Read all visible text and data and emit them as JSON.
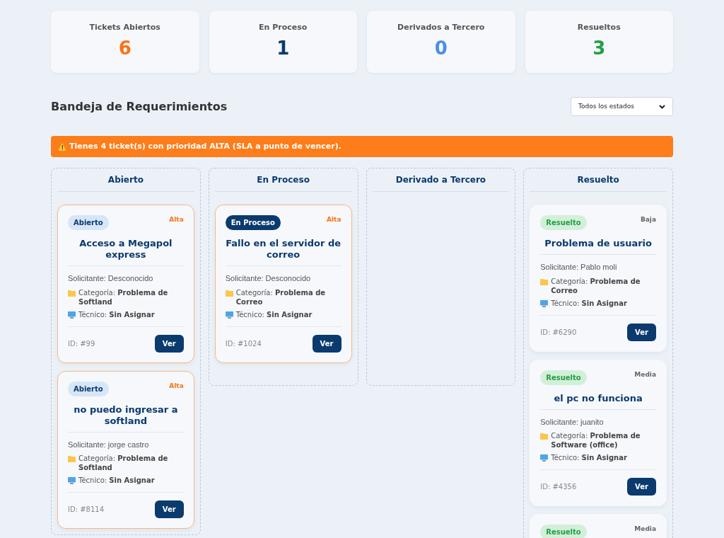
{
  "stats": [
    {
      "label": "Tickets Abiertos",
      "value": "6",
      "color": "#f97316"
    },
    {
      "label": "En Proceso",
      "value": "1",
      "color": "#0b3a6e"
    },
    {
      "label": "Derivados a Tercero",
      "value": "0",
      "color": "#4a90e2"
    },
    {
      "label": "Resueltos",
      "value": "3",
      "color": "#22a045"
    }
  ],
  "inbox": {
    "title": "Bandeja de Requerimientos",
    "filter": {
      "value": "Todos los estados"
    }
  },
  "alert": {
    "icon": "⚠️",
    "text": "Tienes 4 ticket(s) con prioridad ALTA (SLA a punto de vencer)."
  },
  "columns": [
    {
      "title": "Abierto",
      "cards": [
        {
          "kind": "abierto",
          "badge": "Abierto",
          "priority": {
            "label": "Alta",
            "kind": "alta"
          },
          "title": "Acceso a Megapol express",
          "requester": "Solicitante: Desconocido",
          "category_label": "Categoría:",
          "category": "Problema de Softland",
          "tech_label": "Técnico:",
          "tech": "Sin Asignar",
          "id": "ID: #99",
          "button": "Ver"
        },
        {
          "kind": "abierto",
          "badge": "Abierto",
          "priority": {
            "label": "Alta",
            "kind": "alta"
          },
          "title": "no puedo ingresar a softland",
          "requester": "Solicitante: jorge castro",
          "category_label": "Categoría:",
          "category": "Problema de Softland",
          "tech_label": "Técnico:",
          "tech": "Sin Asignar",
          "id": "ID: #8114",
          "button": "Ver"
        }
      ]
    },
    {
      "title": "En Proceso",
      "cards": [
        {
          "kind": "en_proceso",
          "badge": "En Proceso",
          "priority": {
            "label": "Alta",
            "kind": "alta"
          },
          "title": "Fallo en el servidor de correo",
          "requester": "Solicitante: Desconocido",
          "category_label": "Categoría:",
          "category": "Problema de Correo",
          "tech_label": "Técnico:",
          "tech": "Sin Asignar",
          "id": "ID: #1024",
          "button": "Ver"
        }
      ]
    },
    {
      "title": "Derivado a Tercero"
    },
    {
      "title": "Resuelto",
      "cards": [
        {
          "kind": "resuelto",
          "badge": "Resuelto",
          "priority": {
            "label": "Baja",
            "kind": "baja"
          },
          "title": "Problema de usuario",
          "requester": "Solicitante: Pablo moli",
          "category_label": "Categoría:",
          "category": "Problema de Correo",
          "tech_label": "Técnico:",
          "tech": "Sin Asignar",
          "id": "ID: #6290",
          "button": "Ver"
        },
        {
          "kind": "resuelto",
          "badge": "Resuelto",
          "priority": {
            "label": "Media",
            "kind": "media"
          },
          "title": "el pc no funciona",
          "requester": "Solicitante: juanito",
          "category_label": "Categoría:",
          "category": "Problema de Software (office)",
          "tech_label": "Técnico:",
          "tech": "Sin Asignar",
          "id": "ID: #4356",
          "button": "Ver"
        },
        {
          "kind": "resuelto",
          "badge": "Resuelto",
          "priority": {
            "label": "Media",
            "kind": "media"
          }
        }
      ]
    }
  ]
}
